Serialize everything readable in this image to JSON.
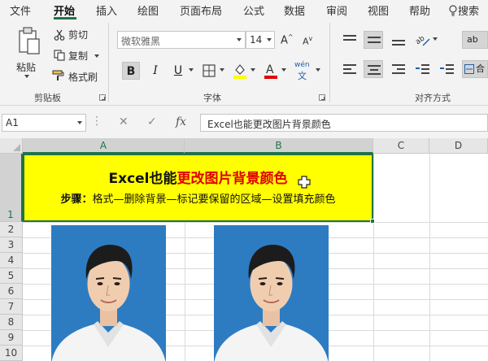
{
  "menu": {
    "tabs": [
      "文件",
      "开始",
      "插入",
      "绘图",
      "页面布局",
      "公式",
      "数据",
      "审阅",
      "视图",
      "帮助"
    ],
    "active_tab": "开始",
    "search_label": "搜索"
  },
  "ribbon": {
    "clipboard": {
      "paste": "粘贴",
      "cut": "剪切",
      "copy": "复制",
      "format_painter": "格式刷",
      "group_label": "剪贴板"
    },
    "font": {
      "font_name": "微软雅黑",
      "font_size": "14",
      "bold": "B",
      "italic": "I",
      "underline": "U",
      "wen": "wén",
      "wen_char": "文",
      "group_label": "字体"
    },
    "alignment": {
      "wrap_label": "ab",
      "merge_label": "合",
      "group_label": "对齐方式"
    }
  },
  "formula_bar": {
    "name_box": "A1",
    "fx": "fx",
    "content": "Excel也能更改图片背景颜色"
  },
  "sheet": {
    "columns": [
      "A",
      "B",
      "C",
      "D"
    ],
    "rows": [
      "1",
      "2",
      "3",
      "4",
      "5",
      "6",
      "7",
      "8",
      "9",
      "10"
    ],
    "a1": {
      "title_plain": "Excel也能",
      "title_highlight": "更改图片背景颜色",
      "steps_label": "步骤：",
      "steps_text": "格式—删除背景—标记要保留的区域—设置填充颜色"
    }
  },
  "colors": {
    "accent": "#217346",
    "cell_fill": "#ffff00",
    "highlight_text": "#e00000",
    "photo_background": "#2d7cc2"
  }
}
